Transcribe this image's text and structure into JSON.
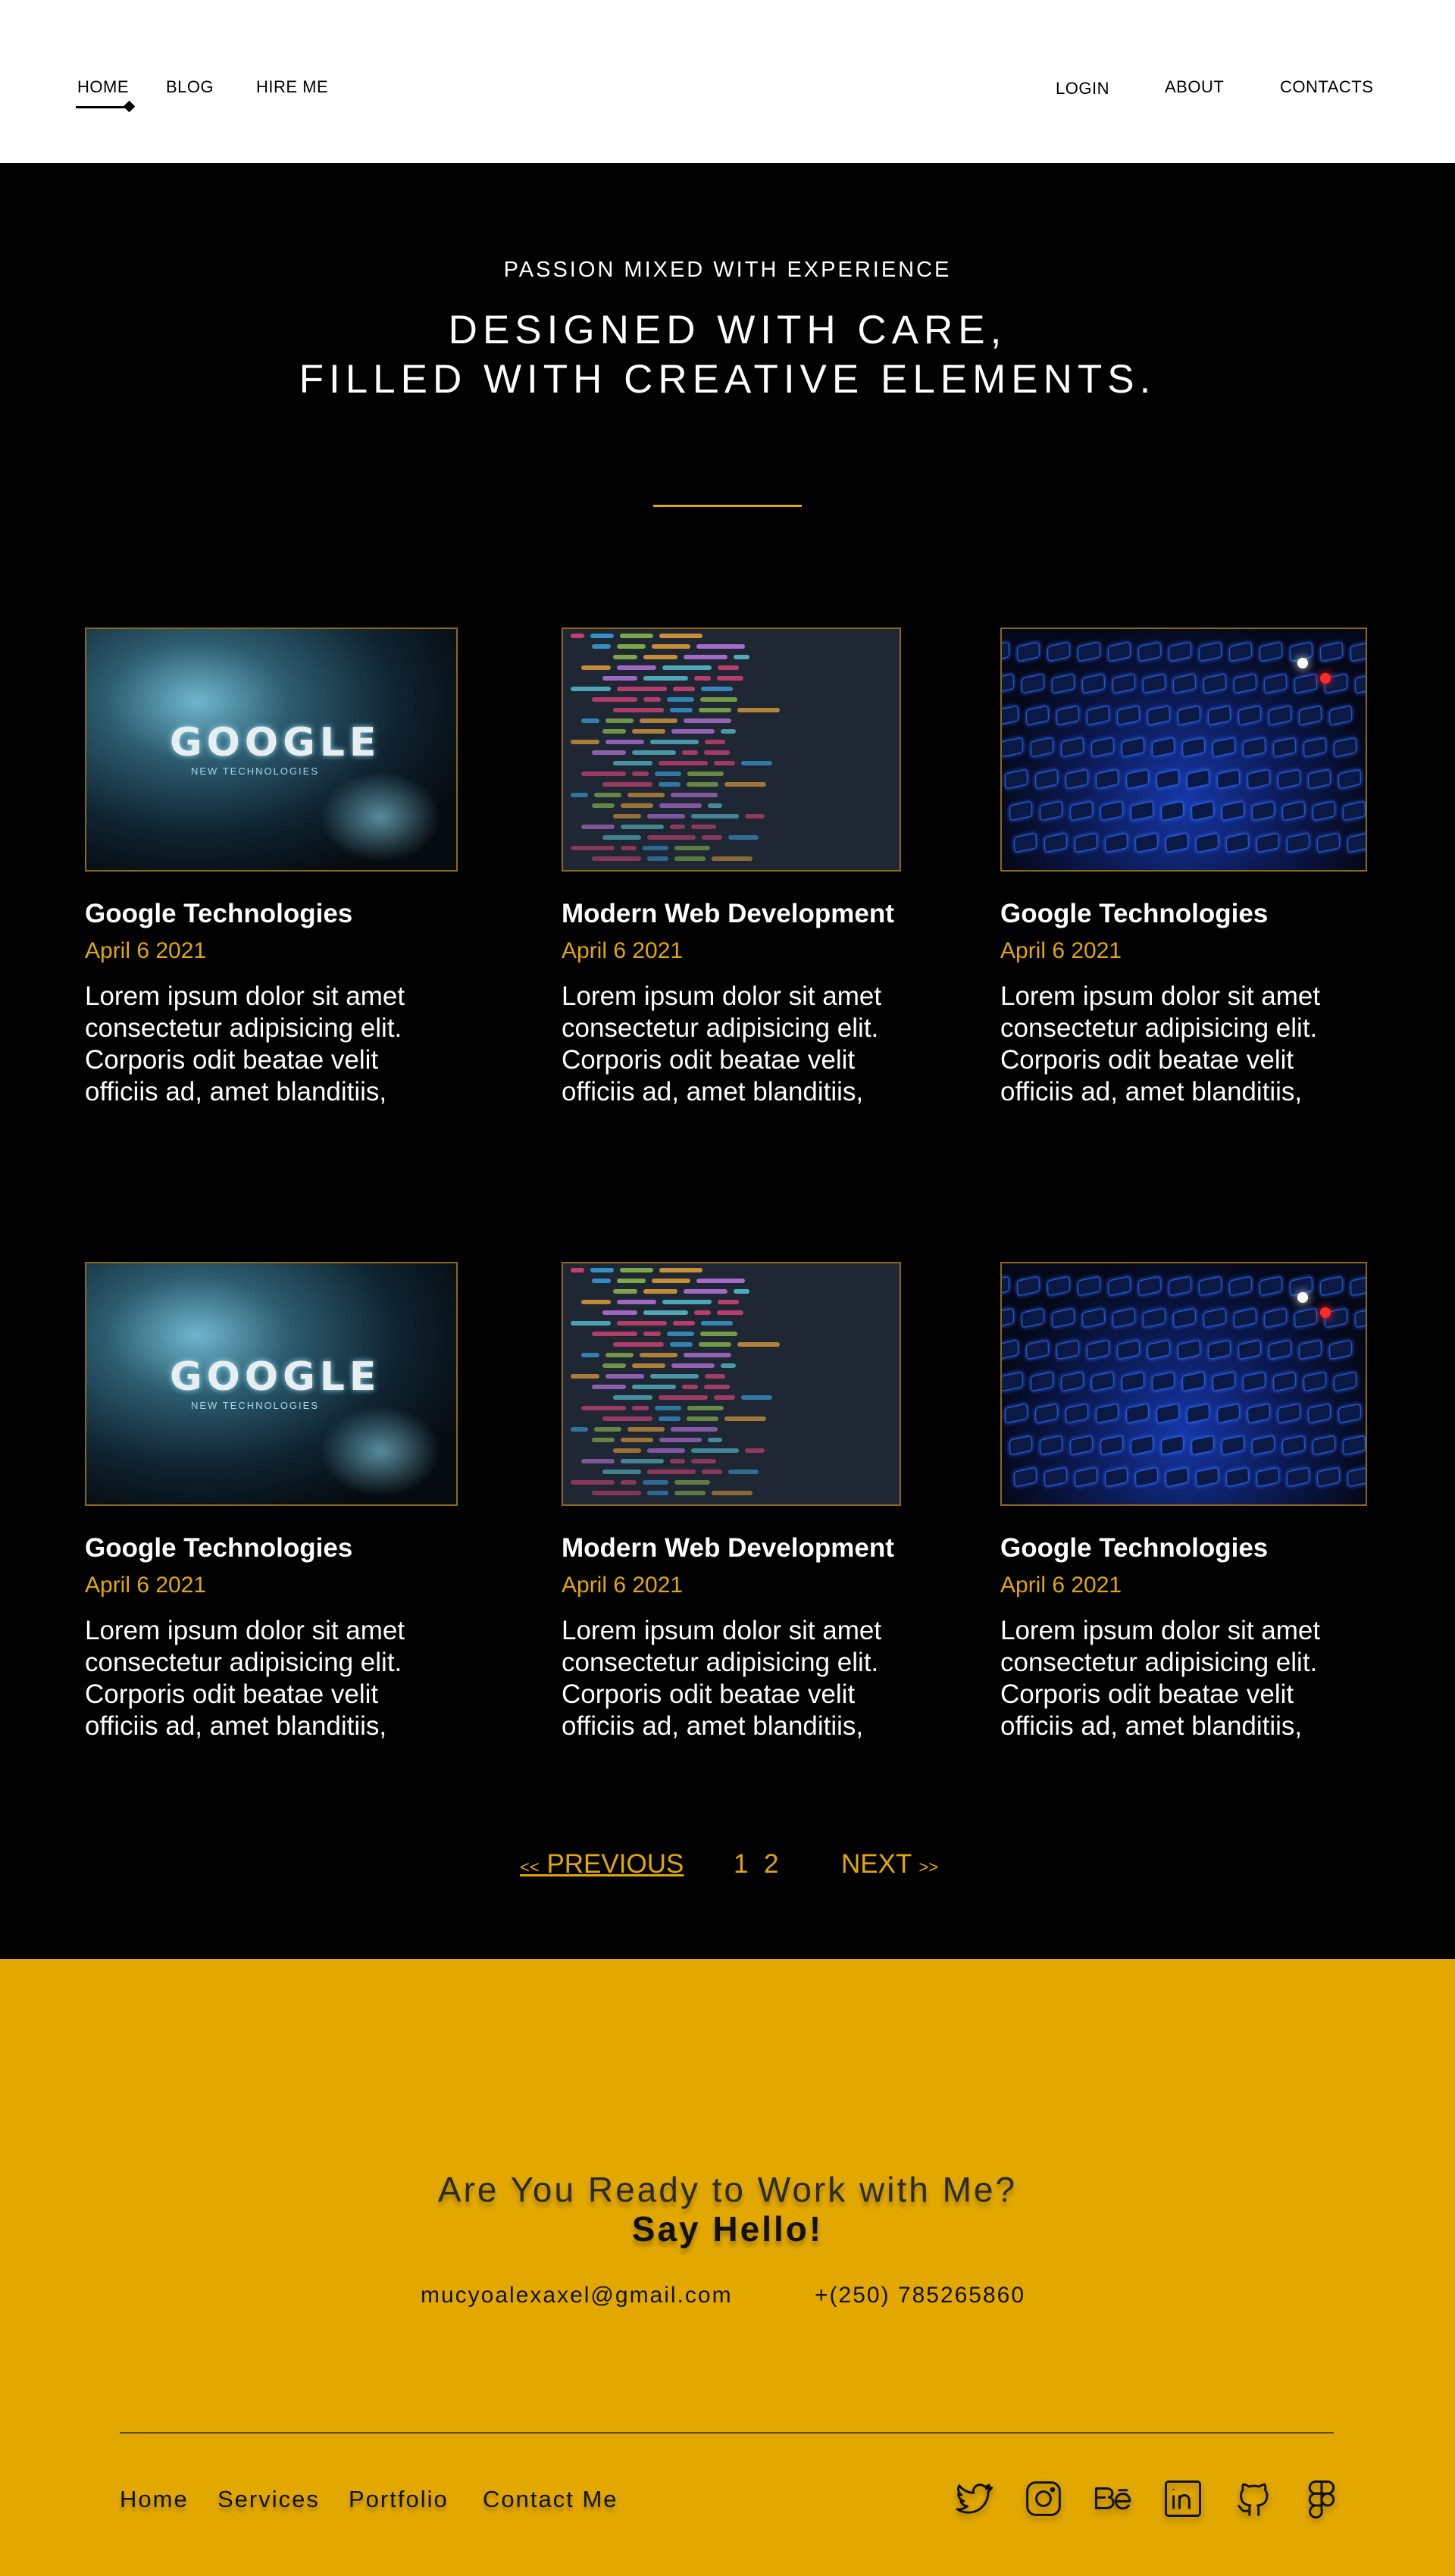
{
  "nav": {
    "left": [
      {
        "label": "HOME"
      },
      {
        "label": "BLOG"
      },
      {
        "label": "HIRE ME"
      }
    ],
    "right": [
      {
        "label": "LOGIN"
      },
      {
        "label": "ABOUT"
      },
      {
        "label": "CONTACTS"
      }
    ],
    "active": "HOME"
  },
  "hero": {
    "eyebrow": "PASSION MIXED  WITH EXPERIENCE",
    "headline_line1": "DESIGNED WITH CARE,",
    "headline_line2": "FILLED WITH CREATIVE ELEMENTS.",
    "accent_color": "#e2a800"
  },
  "posts": [
    {
      "title": "Google Technologies",
      "date": "April 6 2021",
      "excerpt": "Lorem ipsum dolor sit amet consectetur adipisicing elit. Corporis odit beatae velit officiis ad, amet blanditiis,",
      "image": "google-new-technologies",
      "image_text": "GOOGLE",
      "image_subtext": "NEW TECHNOLOGIES"
    },
    {
      "title": "Modern Web Development",
      "date": "April 6 2021",
      "excerpt": "Lorem ipsum dolor sit amet consectetur adipisicing elit. Corporis odit beatae velit officiis ad, amet blanditiis,",
      "image": "code-screen"
    },
    {
      "title": "Google Technologies",
      "date": "April 6 2021",
      "excerpt": "Lorem ipsum dolor sit amet consectetur adipisicing elit. Corporis odit beatae velit officiis ad, amet blanditiis,",
      "image": "backlit-keyboard"
    },
    {
      "title": "Google Technologies",
      "date": "April 6 2021",
      "excerpt": "Lorem ipsum dolor sit amet consectetur adipisicing elit. Corporis odit beatae velit officiis ad, amet blanditiis,",
      "image": "google-new-technologies",
      "image_text": "GOOGLE",
      "image_subtext": "NEW TECHNOLOGIES"
    },
    {
      "title": "Modern Web Development",
      "date": "April 6 2021",
      "excerpt": "Lorem ipsum dolor sit amet consectetur adipisicing elit. Corporis odit beatae velit officiis ad, amet blanditiis,",
      "image": "code-screen"
    },
    {
      "title": "Google Technologies",
      "date": "April 6 2021",
      "excerpt": "Lorem ipsum dolor sit amet consectetur adipisicing elit. Corporis odit beatae velit officiis ad, amet blanditiis,",
      "image": "backlit-keyboard"
    }
  ],
  "pagination": {
    "prev_arrow": "<<",
    "prev_label": "PREVIOUS",
    "pages": [
      "1",
      "2"
    ],
    "next_label": "NEXT",
    "next_arrow": ">>"
  },
  "footer": {
    "question": "Are You Ready to Work with Me?",
    "cta": "Say Hello!",
    "email": "mucyoalexaxel@gmail.com",
    "phone": "+(250) 785265860",
    "links": [
      "Home",
      "Services",
      "Portfolio",
      "Contact Me"
    ],
    "social_icons": [
      "twitter-icon",
      "instagram-icon",
      "behance-icon",
      "linkedin-icon",
      "github-icon",
      "figma-icon"
    ],
    "background_color": "#e2a800"
  }
}
